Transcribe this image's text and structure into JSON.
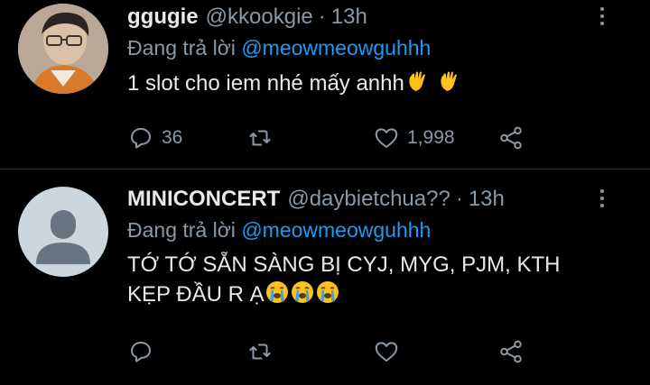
{
  "tweets": [
    {
      "name": "ggugie",
      "handle": "@kkookgie",
      "dot": "·",
      "time": "13h",
      "reply_prefix": "Đang trả lời",
      "reply_to": "@meowmeowguhhh",
      "text": "1 slot cho iem nhé mấy anhh",
      "emojis": [
        "waving-hand",
        "waving-hand"
      ],
      "reply_count": "36",
      "retweet_count": "",
      "like_count": "1,998"
    },
    {
      "name": "MINICONCERT",
      "handle": "@daybietchua??",
      "dot": "·",
      "time": "13h",
      "reply_prefix": "Đang trả lời",
      "reply_to": "@meowmeowguhhh",
      "text_line1": "TỚ TỚ SẴN SÀNG BỊ CYJ, MYG, PJM, KTH",
      "text_line2": "KẸP ĐẦU R Ạ",
      "emojis": [
        "crying-face",
        "crying-face",
        "crying-face"
      ],
      "reply_count": "",
      "retweet_count": "",
      "like_count": ""
    }
  ],
  "colors": {
    "background": "#000000",
    "text": "#e7e9ea",
    "secondary": "#8b98a5",
    "mention": "#1d9bf0",
    "divider": "#2f3336"
  }
}
